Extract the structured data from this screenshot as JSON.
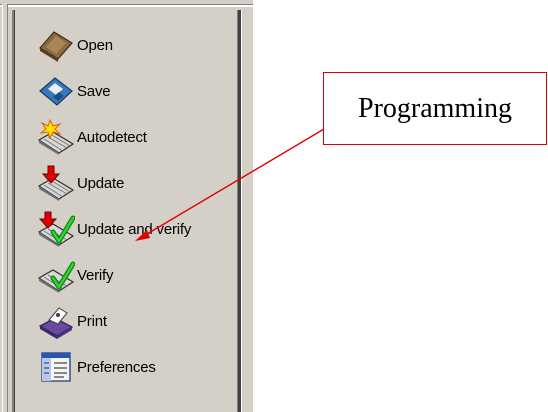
{
  "toolbar": {
    "items": [
      {
        "label": "Open",
        "icon": "folder-open-icon"
      },
      {
        "label": "Save",
        "icon": "floppy-disk-icon"
      },
      {
        "label": "Autodetect",
        "icon": "keyboard-sparkle-icon"
      },
      {
        "label": "Update",
        "icon": "keyboard-red-arrow-icon"
      },
      {
        "label": "Update and verify",
        "icon": "keyboard-arrow-check-icon"
      },
      {
        "label": "Verify",
        "icon": "keyboard-check-icon"
      },
      {
        "label": "Print",
        "icon": "printer-icon"
      },
      {
        "label": "Preferences",
        "icon": "preferences-document-icon"
      }
    ]
  },
  "callout": {
    "text": "Programming",
    "border_color": "#e00000",
    "arrow_color": "#e00000"
  }
}
